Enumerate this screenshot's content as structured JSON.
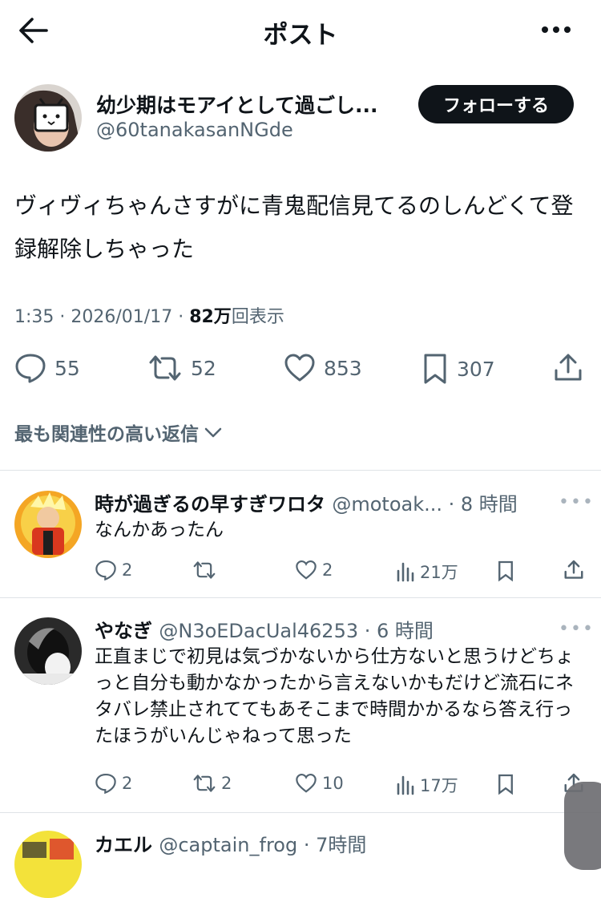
{
  "header": {
    "title": "ポスト"
  },
  "post": {
    "author_name": "幼少期はモアイとして過ごし...",
    "author_handle": "@60tanakasanNGde",
    "follow_label": "フォローする",
    "text": "ヴィヴィちゃんさすがに青鬼配信見てるのしんどくて登録解除しちゃった",
    "time": "1:35",
    "date": "2026/01/17",
    "views": "82万",
    "views_label": "回表示",
    "replies": "55",
    "reposts": "52",
    "likes": "853",
    "bookmarks": "307"
  },
  "sort": {
    "label": "最も関連性の高い返信"
  },
  "replies": [
    {
      "name": "時が過ぎるの早すぎワロタ",
      "handle": "@motoak...",
      "time": "8 時間",
      "text": "なんかあったん",
      "replies": "2",
      "reposts": "",
      "likes": "2",
      "views": "21万"
    },
    {
      "name": "やなぎ",
      "handle": "@N3oEDacUal46253",
      "time": "6 時間",
      "text": "正直まじで初見は気づかないから仕方ないと思うけどちょっと自分も動かなかったから言えないかもだけど流石にネタバレ禁止されててもあそこまで時間かかるなら答え行ったほうがいんじゃねって思った",
      "replies": "2",
      "reposts": "2",
      "likes": "10",
      "views": "17万"
    },
    {
      "name": "カエル",
      "handle": "@captain_frog",
      "time": "7時間"
    }
  ],
  "colors": {
    "text": "#0f1419",
    "secondary": "#536471",
    "divider": "#dfe3e7",
    "button_bg": "#0f1419"
  }
}
